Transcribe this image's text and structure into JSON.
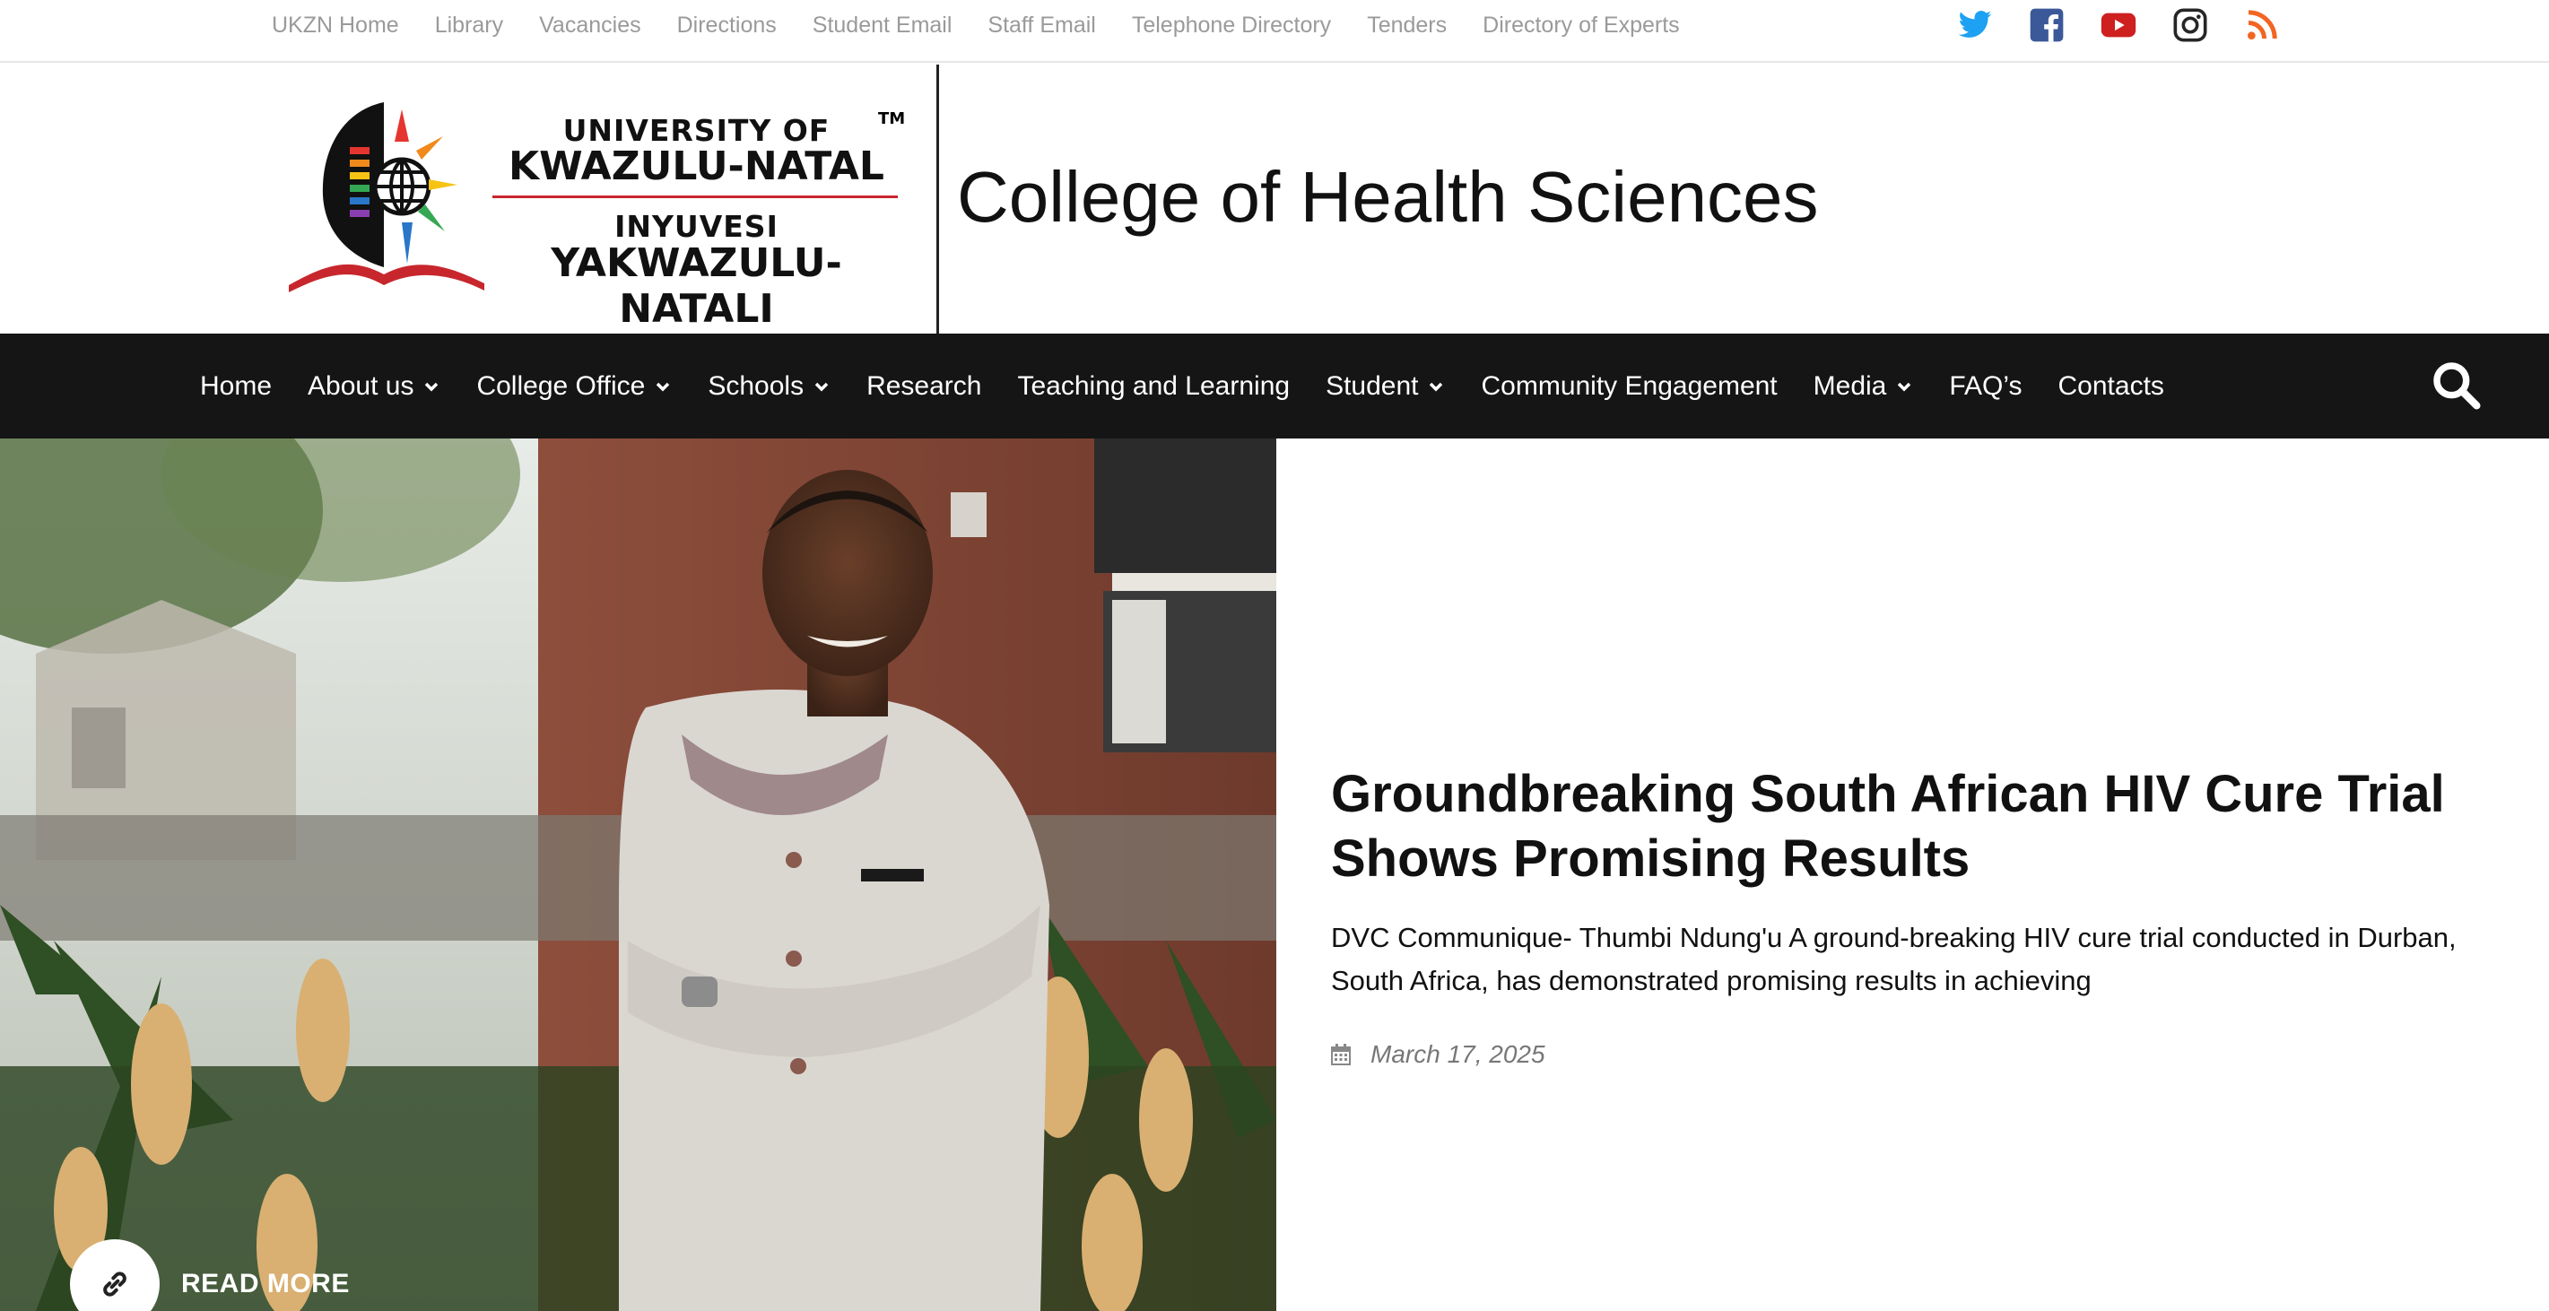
{
  "topbar": {
    "links": [
      "UKZN Home",
      "Library",
      "Vacancies",
      "Directions",
      "Student Email",
      "Staff Email",
      "Telephone Directory",
      "Tenders",
      "Directory of Experts"
    ],
    "social": [
      {
        "icon": "twitter-icon",
        "color": "#1da1f2"
      },
      {
        "icon": "facebook-icon",
        "color": "#3b5998"
      },
      {
        "icon": "youtube-icon",
        "color": "#cd201f"
      },
      {
        "icon": "instagram-icon",
        "color": "#262626"
      },
      {
        "icon": "rss-icon",
        "color": "#f26522"
      }
    ]
  },
  "header": {
    "logo": {
      "line1": "UNIVERSITY OF",
      "line2": "KWAZULU-NATAL",
      "line3": "INYUVESI",
      "line4": "YAKWAZULU-NATALI",
      "tm": "TM"
    },
    "college_title": "College of Health Sciences"
  },
  "nav": {
    "items": [
      {
        "label": "Home",
        "dropdown": false
      },
      {
        "label": "About us",
        "dropdown": true
      },
      {
        "label": "College Office",
        "dropdown": true
      },
      {
        "label": "Schools",
        "dropdown": true
      },
      {
        "label": "Research",
        "dropdown": false
      },
      {
        "label": "Teaching and Learning",
        "dropdown": false
      },
      {
        "label": "Student",
        "dropdown": true
      },
      {
        "label": "Community Engagement",
        "dropdown": false
      },
      {
        "label": "Media",
        "dropdown": true
      },
      {
        "label": "FAQ’s",
        "dropdown": false
      },
      {
        "label": "Contacts",
        "dropdown": false
      }
    ],
    "search_icon": "search-icon"
  },
  "hero": {
    "read_more": "READ MORE",
    "title": "Groundbreaking South African HIV Cure Trial Shows Promising Results",
    "excerpt": "DVC Communique- Thumbi Ndung'u A ground-breaking HIV cure trial conducted in Durban, South Africa, has demonstrated promising results in achieving",
    "date": "March 17, 2025"
  },
  "colors": {
    "nav_bg": "#151515",
    "toplink": "#9a9a9a",
    "brand_red": "#c8262d"
  }
}
